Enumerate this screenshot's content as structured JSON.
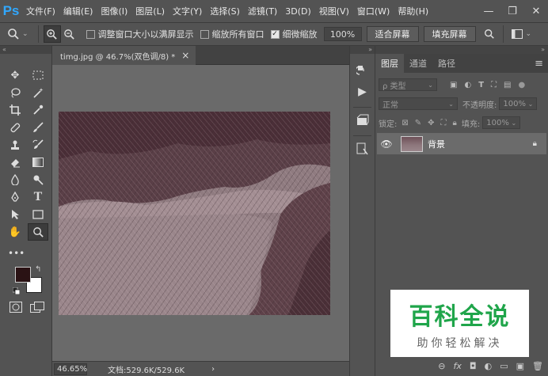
{
  "app": {
    "logo": "Ps"
  },
  "menu": [
    "文件(F)",
    "编辑(E)",
    "图像(I)",
    "图层(L)",
    "文字(Y)",
    "选择(S)",
    "滤镜(T)",
    "3D(D)",
    "视图(V)",
    "窗口(W)",
    "帮助(H)"
  ],
  "window_controls": {
    "minimize": "—",
    "restore": "❐",
    "close": "✕"
  },
  "options": {
    "resize_windows_label": "调整窗口大小以满屏显示",
    "zoom_all_label": "缩放所有窗口",
    "scrubby_label": "细微缩放",
    "zoom_value": "100%",
    "fit_screen": "适合屏幕",
    "fill_screen": "填充屏幕"
  },
  "document": {
    "tab_title": "timg.jpg @ 46.7%(双色调/8) *",
    "tab_close": "×",
    "zoom": "46.65%",
    "doc_size": "文档:529.6K/529.6K",
    "status_arrow": "›"
  },
  "layers_panel": {
    "tabs": [
      "图层",
      "通道",
      "路径"
    ],
    "filter_label": "ρ 类型",
    "blend_mode": "正常",
    "opacity_label": "不透明度:",
    "opacity_value": "100%",
    "lock_label": "锁定:",
    "fill_label": "填充:",
    "fill_value": "100%",
    "layer_name": "背景",
    "bottom_icons": [
      "⊖",
      "fx",
      "◘",
      "◐",
      "▭",
      "▣",
      "🗑"
    ]
  },
  "watermark": {
    "line1": "百科全说",
    "line2": "助你轻松解决"
  },
  "colors": {
    "bg": "#535353",
    "logo": "#31a8ff",
    "foreground": "#2a1214",
    "background": "#ffffff",
    "watermark": "#1fa54a"
  }
}
